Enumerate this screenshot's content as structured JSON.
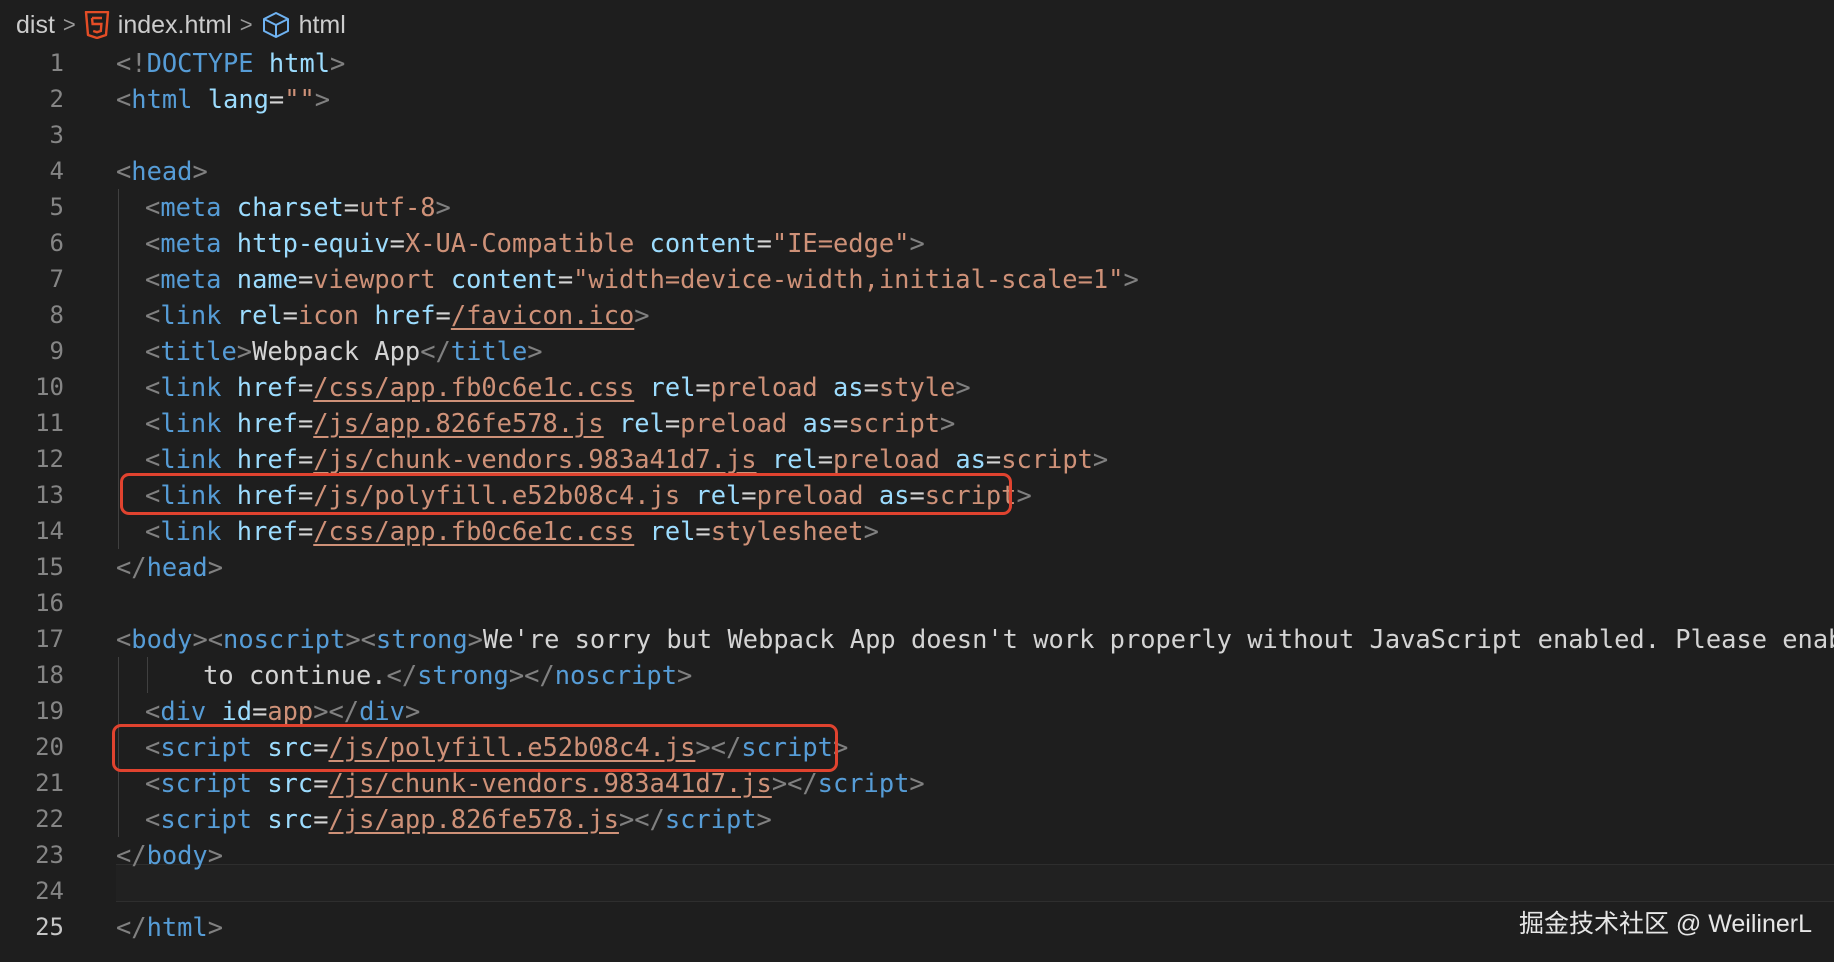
{
  "breadcrumb": {
    "folder": "dist",
    "file": "index.html",
    "symbol": "html",
    "file_icon": "html5-icon",
    "symbol_icon": "cube-icon",
    "separator": ">"
  },
  "code_lines": [
    [
      [
        "t",
        "<!"
      ],
      [
        "tag",
        "DOCTYPE"
      ],
      [
        "txt",
        " "
      ],
      [
        "attr",
        "html"
      ],
      [
        "t",
        ">"
      ]
    ],
    [
      [
        "t",
        "<"
      ],
      [
        "tag",
        "html"
      ],
      [
        "txt",
        " "
      ],
      [
        "attr",
        "lang"
      ],
      [
        "txt",
        "="
      ],
      [
        "val",
        "\"\""
      ],
      [
        "t",
        ">"
      ]
    ],
    [],
    [
      [
        "t",
        "<"
      ],
      [
        "tag",
        "head"
      ],
      [
        "t",
        ">"
      ]
    ],
    [
      [
        "t",
        "<"
      ],
      [
        "tag",
        "meta"
      ],
      [
        "txt",
        " "
      ],
      [
        "attr",
        "charset"
      ],
      [
        "txt",
        "="
      ],
      [
        "val",
        "utf-8"
      ],
      [
        "t",
        ">"
      ]
    ],
    [
      [
        "t",
        "<"
      ],
      [
        "tag",
        "meta"
      ],
      [
        "txt",
        " "
      ],
      [
        "attr",
        "http-equiv"
      ],
      [
        "txt",
        "="
      ],
      [
        "val",
        "X-UA-Compatible"
      ],
      [
        "txt",
        " "
      ],
      [
        "attr",
        "content"
      ],
      [
        "txt",
        "="
      ],
      [
        "val",
        "\"IE=edge\""
      ],
      [
        "t",
        ">"
      ]
    ],
    [
      [
        "t",
        "<"
      ],
      [
        "tag",
        "meta"
      ],
      [
        "txt",
        " "
      ],
      [
        "attr",
        "name"
      ],
      [
        "txt",
        "="
      ],
      [
        "val",
        "viewport"
      ],
      [
        "txt",
        " "
      ],
      [
        "attr",
        "content"
      ],
      [
        "txt",
        "="
      ],
      [
        "val",
        "\"width=device-width,initial-scale=1\""
      ],
      [
        "t",
        ">"
      ]
    ],
    [
      [
        "t",
        "<"
      ],
      [
        "tag",
        "link"
      ],
      [
        "txt",
        " "
      ],
      [
        "attr",
        "rel"
      ],
      [
        "txt",
        "="
      ],
      [
        "val",
        "icon"
      ],
      [
        "txt",
        " "
      ],
      [
        "attr",
        "href"
      ],
      [
        "txt",
        "="
      ],
      [
        "val-link",
        "/favicon.ico"
      ],
      [
        "t",
        ">"
      ]
    ],
    [
      [
        "t",
        "<"
      ],
      [
        "tag",
        "title"
      ],
      [
        "t",
        ">"
      ],
      [
        "txt",
        "Webpack App"
      ],
      [
        "t",
        "</"
      ],
      [
        "tag",
        "title"
      ],
      [
        "t",
        ">"
      ]
    ],
    [
      [
        "t",
        "<"
      ],
      [
        "tag",
        "link"
      ],
      [
        "txt",
        " "
      ],
      [
        "attr",
        "href"
      ],
      [
        "txt",
        "="
      ],
      [
        "val-link",
        "/css/app.fb0c6e1c.css"
      ],
      [
        "txt",
        " "
      ],
      [
        "attr",
        "rel"
      ],
      [
        "txt",
        "="
      ],
      [
        "val",
        "preload"
      ],
      [
        "txt",
        " "
      ],
      [
        "attr",
        "as"
      ],
      [
        "txt",
        "="
      ],
      [
        "val",
        "style"
      ],
      [
        "t",
        ">"
      ]
    ],
    [
      [
        "t",
        "<"
      ],
      [
        "tag",
        "link"
      ],
      [
        "txt",
        " "
      ],
      [
        "attr",
        "href"
      ],
      [
        "txt",
        "="
      ],
      [
        "val-link",
        "/js/app.826fe578.js"
      ],
      [
        "txt",
        " "
      ],
      [
        "attr",
        "rel"
      ],
      [
        "txt",
        "="
      ],
      [
        "val",
        "preload"
      ],
      [
        "txt",
        " "
      ],
      [
        "attr",
        "as"
      ],
      [
        "txt",
        "="
      ],
      [
        "val",
        "script"
      ],
      [
        "t",
        ">"
      ]
    ],
    [
      [
        "t",
        "<"
      ],
      [
        "tag",
        "link"
      ],
      [
        "txt",
        " "
      ],
      [
        "attr",
        "href"
      ],
      [
        "txt",
        "="
      ],
      [
        "val-link",
        "/js/chunk-vendors.983a41d7.js"
      ],
      [
        "txt",
        " "
      ],
      [
        "attr",
        "rel"
      ],
      [
        "txt",
        "="
      ],
      [
        "val",
        "preload"
      ],
      [
        "txt",
        " "
      ],
      [
        "attr",
        "as"
      ],
      [
        "txt",
        "="
      ],
      [
        "val",
        "script"
      ],
      [
        "t",
        ">"
      ]
    ],
    [
      [
        "t",
        "<"
      ],
      [
        "tag",
        "link"
      ],
      [
        "txt",
        " "
      ],
      [
        "attr",
        "href"
      ],
      [
        "txt",
        "="
      ],
      [
        "val",
        "/js/polyfill.e52b08c4.js"
      ],
      [
        "txt",
        " "
      ],
      [
        "attr",
        "rel"
      ],
      [
        "txt",
        "="
      ],
      [
        "val",
        "preload"
      ],
      [
        "txt",
        " "
      ],
      [
        "attr",
        "as"
      ],
      [
        "txt",
        "="
      ],
      [
        "val",
        "script"
      ],
      [
        "t",
        ">"
      ]
    ],
    [
      [
        "t",
        "<"
      ],
      [
        "tag",
        "link"
      ],
      [
        "txt",
        " "
      ],
      [
        "attr",
        "href"
      ],
      [
        "txt",
        "="
      ],
      [
        "val-link",
        "/css/app.fb0c6e1c.css"
      ],
      [
        "txt",
        " "
      ],
      [
        "attr",
        "rel"
      ],
      [
        "txt",
        "="
      ],
      [
        "val",
        "stylesheet"
      ],
      [
        "t",
        ">"
      ]
    ],
    [
      [
        "t",
        "</"
      ],
      [
        "tag",
        "head"
      ],
      [
        "t",
        ">"
      ]
    ],
    [],
    [
      [
        "t",
        "<"
      ],
      [
        "tag",
        "body"
      ],
      [
        "t",
        "><"
      ],
      [
        "tag",
        "noscript"
      ],
      [
        "t",
        "><"
      ],
      [
        "tag",
        "strong"
      ],
      [
        "t",
        ">"
      ],
      [
        "txt",
        "We're sorry but Webpack App doesn't work properly without JavaScript enabled. Please enable it"
      ]
    ],
    [
      [
        "txt",
        "to continue."
      ],
      [
        "t",
        "</"
      ],
      [
        "tag",
        "strong"
      ],
      [
        "t",
        "></"
      ],
      [
        "tag",
        "noscript"
      ],
      [
        "t",
        ">"
      ]
    ],
    [
      [
        "t",
        "<"
      ],
      [
        "tag",
        "div"
      ],
      [
        "txt",
        " "
      ],
      [
        "attr",
        "id"
      ],
      [
        "txt",
        "="
      ],
      [
        "val",
        "app"
      ],
      [
        "t",
        "></"
      ],
      [
        "tag",
        "div"
      ],
      [
        "t",
        ">"
      ]
    ],
    [
      [
        "t",
        "<"
      ],
      [
        "tag",
        "script"
      ],
      [
        "txt",
        " "
      ],
      [
        "attr",
        "src"
      ],
      [
        "txt",
        "="
      ],
      [
        "val-link",
        "/js/polyfill.e52b08c4.js"
      ],
      [
        "t",
        "></"
      ],
      [
        "tag",
        "script"
      ],
      [
        "t",
        ">"
      ]
    ],
    [
      [
        "t",
        "<"
      ],
      [
        "tag",
        "script"
      ],
      [
        "txt",
        " "
      ],
      [
        "attr",
        "src"
      ],
      [
        "txt",
        "="
      ],
      [
        "val-link",
        "/js/chunk-vendors.983a41d7.js"
      ],
      [
        "t",
        "></"
      ],
      [
        "tag",
        "script"
      ],
      [
        "t",
        ">"
      ]
    ],
    [
      [
        "t",
        "<"
      ],
      [
        "tag",
        "script"
      ],
      [
        "txt",
        " "
      ],
      [
        "attr",
        "src"
      ],
      [
        "txt",
        "="
      ],
      [
        "val-link",
        "/js/app.826fe578.js"
      ],
      [
        "t",
        "></"
      ],
      [
        "tag",
        "script"
      ],
      [
        "t",
        ">"
      ]
    ],
    [
      [
        "t",
        "</"
      ],
      [
        "tag",
        "body"
      ],
      [
        "t",
        ">"
      ]
    ],
    [],
    [
      [
        "t",
        "</"
      ],
      [
        "tag",
        "html"
      ],
      [
        "t",
        ">"
      ]
    ]
  ],
  "indent_levels": [
    0,
    0,
    0,
    0,
    1,
    1,
    1,
    1,
    1,
    1,
    1,
    1,
    1,
    1,
    0,
    0,
    0,
    3,
    1,
    1,
    1,
    1,
    0,
    0,
    0
  ],
  "highlighted_lines": [
    13,
    20
  ],
  "active_line": 25,
  "watermark": "掘金技术社区 @ WeilinerL",
  "colors": {
    "background": "#1e1e1e",
    "tag": "#569cd6",
    "attribute": "#9cdcfe",
    "string": "#ce9178",
    "punctuation": "#808080",
    "text": "#d4d4d4",
    "highlight_box": "#e0432f"
  }
}
